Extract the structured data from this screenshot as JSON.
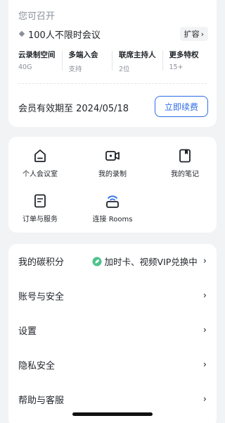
{
  "membership": {
    "title": "您可召开",
    "plan_name": "100人不限时会议",
    "expand_label": "扩容",
    "features": [
      {
        "name": "云录制空间",
        "value": "40G"
      },
      {
        "name": "多端入会",
        "value": "支持"
      },
      {
        "name": "联席主持人",
        "value": "2位"
      },
      {
        "name": "更多特权",
        "value": "15+"
      }
    ],
    "expiry_text": "会员有效期至 2024/05/18",
    "renew_label": "立即续费"
  },
  "shortcuts": [
    {
      "label": "个人会议室",
      "icon": "personal-room-icon"
    },
    {
      "label": "我的录制",
      "icon": "recording-icon"
    },
    {
      "label": "我的笔记",
      "icon": "notes-icon"
    },
    {
      "label": "订单与服务",
      "icon": "orders-icon"
    },
    {
      "label": "连接 Rooms",
      "icon": "rooms-icon"
    }
  ],
  "menu": {
    "items": [
      {
        "label": "我的碳积分",
        "extra": "加时卡、视频VIP兑换中"
      },
      {
        "label": "账号与安全"
      },
      {
        "label": "设置"
      },
      {
        "label": "隐私安全"
      },
      {
        "label": "帮助与客服"
      }
    ],
    "chevron": "›"
  },
  "colors": {
    "accent": "#2e6be6",
    "leaf": "#4cc38a",
    "background": "#f2f3f5"
  }
}
